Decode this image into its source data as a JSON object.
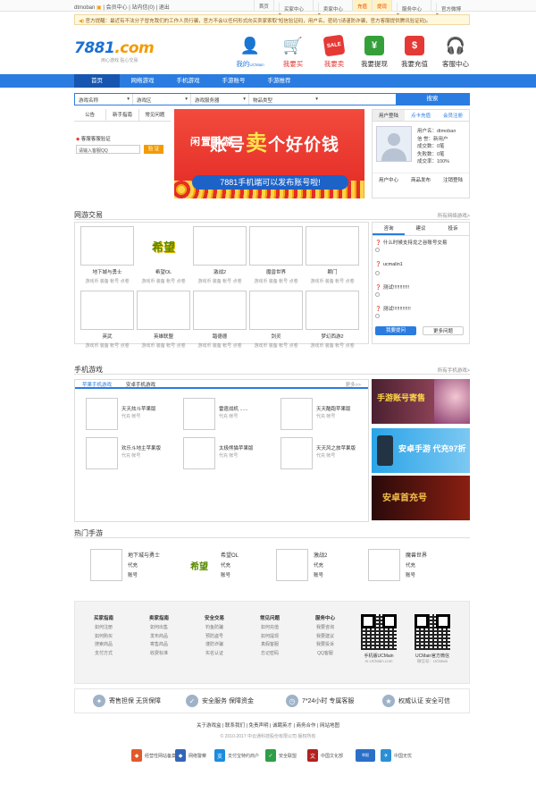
{
  "topbar": {
    "user": "dtmoban",
    "links": [
      "会员中心",
      "站内信(0)",
      "退出"
    ],
    "right": [
      "首页",
      "买家中心",
      "卖家中心",
      "充值",
      "提现",
      "服务中心",
      "官方微博"
    ]
  },
  "notice": "官方提醒：最近有不法分子冒充我们的工作人员行骗，官方不会以任何形式向买卖家索取“短信验证码，用户名，密码”(请谨防诈骗，官方客服提供腾讯验证码)。",
  "logo": {
    "main": "7881",
    "suffix": ".com",
    "slogan": "用心游戏 贴心交易"
  },
  "header_nav": [
    {
      "label": "我的",
      "sub": "UCMain",
      "icon": "user-icon",
      "color": "#2a7ce0"
    },
    {
      "label": "我要买",
      "icon": "cart-icon",
      "color": "#e53935"
    },
    {
      "label": "我要卖",
      "icon": "sale-icon",
      "color": "#e53935",
      "badge": "SALE"
    },
    {
      "label": "我要提现",
      "icon": "cash-icon",
      "color": "#35a03a",
      "glyph": "¥"
    },
    {
      "label": "我要充值",
      "icon": "bag-icon",
      "color": "#e53935",
      "glyph": "$"
    },
    {
      "label": "客服中心",
      "icon": "headset-icon",
      "color": "#555"
    }
  ],
  "main_nav": [
    "首页",
    "网络游戏",
    "手机游戏",
    "手游账号",
    "手游推荐"
  ],
  "search": {
    "fields": [
      "游戏名称",
      "游戏区",
      "游戏服务器",
      "物品类型"
    ],
    "button": "搜索"
  },
  "left_panel": {
    "tabs": [
      "公告",
      "新手指南",
      "常见问题"
    ],
    "verify_title": "客服客服验证",
    "qq_placeholder": "请输入客服QQ",
    "verify_button": "验 证"
  },
  "banner": {
    "line1a": "闲置手游",
    "line1b": "账号",
    "big": "卖",
    "line1c": "个好价钱",
    "line2": "7881手机端可以发布账号啦!"
  },
  "user_box": {
    "tabs": [
      "用户登陆",
      "点卡充值",
      "会员注册"
    ],
    "info": [
      "用户名：dtmoban",
      "信 誉：新用户",
      "成交数：0笔",
      "失败数：0笔",
      "成交率：100%"
    ],
    "links": [
      "用户中心",
      "商品发布",
      "注销登陆"
    ]
  },
  "online_games": {
    "title": "网游交易",
    "more": "所有网络游戏>",
    "items": [
      {
        "name": "地下城与勇士",
        "sub": "游戏币 装备 帐号 点卷"
      },
      {
        "name": "希望OL",
        "sub": "游戏币 装备 帐号 点卷",
        "logo": "希望"
      },
      {
        "name": "激战2",
        "sub": "游戏币 装备 帐号 点卷"
      },
      {
        "name": "魔兽世界",
        "sub": "游戏币 装备 帐号 点卷"
      },
      {
        "name": "颗门",
        "sub": "游戏币 装备 帐号 点卷"
      },
      {
        "name": "英武",
        "sub": "游戏币 装备 帐号 点卷"
      },
      {
        "name": "英雄联盟",
        "sub": "游戏币 装备 帐号 点卷"
      },
      {
        "name": "踏德德",
        "sub": "游戏币 装备 帐号 点卷"
      },
      {
        "name": "剑灵",
        "sub": "游戏币 装备 帐号 点卷"
      },
      {
        "name": "梦幻西游2",
        "sub": "游戏币 装备 帐号 点卷"
      }
    ]
  },
  "qa": {
    "tabs": [
      "咨询",
      "建议",
      "投诉"
    ],
    "items": [
      "什么时候支持龙之谷账号交易",
      "ucmalin1",
      "测试!!!!!!!!!!!!",
      "测试!!!!!!!!!!!!!"
    ],
    "ask_button": "我要提问",
    "more_button": "更多问题"
  },
  "mobile_games": {
    "title": "手机游戏",
    "more": "所有手机游戏>",
    "tabs": [
      "苹果手机游戏",
      "安卓手机游戏"
    ],
    "tab_more": "更多>>",
    "items": [
      {
        "name": "天天炫斗苹果版",
        "desc": "代充 帐号"
      },
      {
        "name": "雷霆战机 ......",
        "desc": "代充 帐号"
      },
      {
        "name": "天天酷跑苹果版",
        "desc": "代充 帐号"
      },
      {
        "name": "欢乐斗地主苹果版",
        "desc": "代充 帐号"
      },
      {
        "name": "太极熊猫苹果版",
        "desc": "代充 帐号"
      },
      {
        "name": "天天风之旅苹果版",
        "desc": "代充 帐号"
      }
    ],
    "ads": [
      "手游账号寄售",
      "安卓手游 代充97折",
      "安卓首充号"
    ]
  },
  "hot_games": {
    "title": "热门手游",
    "items": [
      {
        "name": "地下城与勇士",
        "l2": "代充",
        "l3": "账号"
      },
      {
        "name": "希望OL",
        "l2": "代充",
        "l3": "账号"
      },
      {
        "name": "激战2",
        "l2": "代充",
        "l3": "账号"
      },
      {
        "name": "魔兽世界",
        "l2": "代充",
        "l3": "账号"
      }
    ]
  },
  "footer": {
    "columns": [
      {
        "h": "买家指南",
        "a": [
          "如何注册",
          "如何购买",
          "搜索商品",
          "支付方式"
        ]
      },
      {
        "h": "卖家指南",
        "a": [
          "如何出售",
          "发布商品",
          "寄售商品",
          "收费标准"
        ]
      },
      {
        "h": "安全交易",
        "a": [
          "钓鱼防骗",
          "预防盗号",
          "谨防诈骗",
          "实名认证"
        ]
      },
      {
        "h": "常见问题",
        "a": [
          "如何充值",
          "如何提现",
          "真假客服",
          "忘记密码"
        ]
      },
      {
        "h": "服务中心",
        "a": [
          "我要咨询",
          "我要建议",
          "我要投诉",
          "QQ客服"
        ]
      }
    ],
    "qr": [
      {
        "label": "手机版UCMain",
        "sub": "m.UCMain.com"
      },
      {
        "label": "UCMain官方微信",
        "sub": "微信号：UCMain"
      }
    ]
  },
  "guarantees": [
    "寄售担保  无货保障",
    "安全服务  保障资金",
    "7*24小时 专属客服",
    "权威认证  安全可信"
  ],
  "footer_links": [
    "关于游戏盒",
    "联系我们",
    "免责声明",
    "诚聘英才",
    "商务合作",
    "网站地图"
  ],
  "copyright": "© 2010-2017 中云通科技股份有限公司 版权所有",
  "certs": [
    {
      "label": "经营性网站备案信息",
      "color": "#e35a2a"
    },
    {
      "label": "网络警察",
      "color": "#3466b6"
    },
    {
      "label": "支付宝特约商户",
      "color": "#1a8ce0"
    },
    {
      "label": "安全联盟",
      "color": "#2e9e48"
    },
    {
      "label": "中国文化部",
      "color": "#b32020"
    },
    {
      "label": "中国互联网举报中心",
      "color": "#2a6fc8"
    },
    {
      "label": "中国无忧",
      "color": "#2b8fd6"
    }
  ]
}
